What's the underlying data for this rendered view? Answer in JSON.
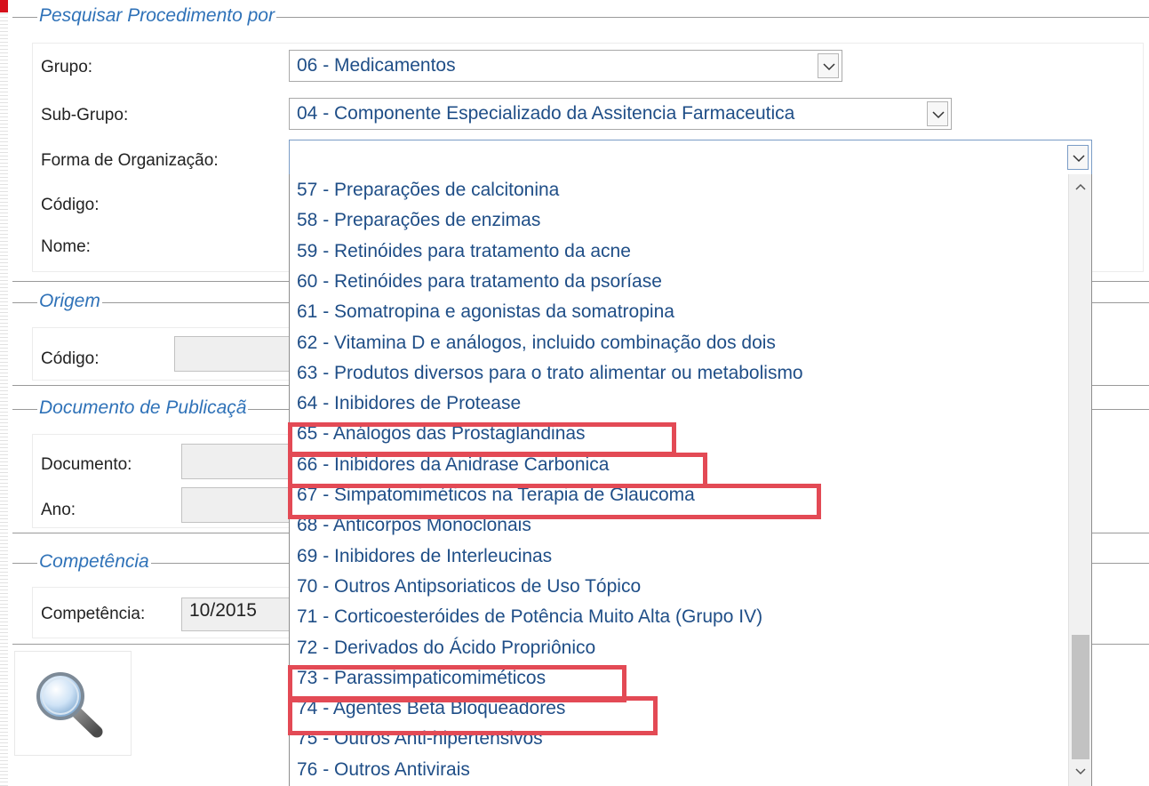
{
  "sections": {
    "pesquisar": "Pesquisar Procedimento por",
    "origem": "Origem",
    "documento": "Documento de Publicaçã",
    "competencia": "Competência"
  },
  "fields": {
    "grupo_label": "Grupo:",
    "grupo_value": "06 - Medicamentos",
    "subgrupo_label": "Sub-Grupo:",
    "subgrupo_value": "04 - Componente Especializado da Assitencia Farmaceutica",
    "forma_label": "Forma de Organização:",
    "forma_value": "",
    "codigo_label": "Código:",
    "nome_label": "Nome:",
    "origem_codigo_label": "Código:",
    "documento_label": "Documento:",
    "ano_label": "Ano:",
    "competencia_label": "Competência:",
    "competencia_value": "10/2015"
  },
  "dropdown_items": [
    "57 - Preparações de calcitonina",
    "58 - Preparações de enzimas",
    "59 - Retinóides para tratamento da acne",
    "60 - Retinóides para tratamento da psoríase",
    "61 - Somatropina e agonistas da somatropina",
    "62 - Vitamina D e análogos, incluido combinação dos dois",
    "63 - Produtos diversos para o trato alimentar ou metabolismo",
    "64 - Inibidores de Protease",
    "65 - Análogos das Prostaglandinas",
    "66 - Inibidores da Anidrase Carbonica",
    "67 - Simpatomiméticos na Terapia de Glaucoma",
    "68 - Anticorpos Monoclonais",
    "69 - Inibidores de Interleucinas",
    "70 - Outros Antipsoriaticos de Uso Tópico",
    "71 - Corticoesteróides de Potência Muito Alta (Grupo IV)",
    "72 - Derivados do Ácido Propriônico",
    "73 - Parassimpaticomiméticos",
    "74 - Agentes Beta Bloqueadores",
    "75 - Outros Anti-hipertensivos",
    "76 - Outros Antivirais"
  ],
  "highlighted_items": [
    "65 - Análogos das Prostaglandinas",
    "66 - Inibidores da Anidrase Carbonica",
    "67 - Simpatomiméticos na Terapia de Glaucoma",
    "73 - Parassimpaticomiméticos",
    "74 - Agentes Beta Bloqueadores"
  ],
  "icons": {
    "search": "magnifier-icon",
    "combo_arrow": "chevron-down-icon",
    "scroll_up": "chevron-up-icon",
    "scroll_down": "chevron-down-icon"
  },
  "colors": {
    "legend": "#2f72b8",
    "dropdown_text": "#1f4e87",
    "highlight_box": "#e34a55",
    "corner_mark": "#d6101b"
  }
}
